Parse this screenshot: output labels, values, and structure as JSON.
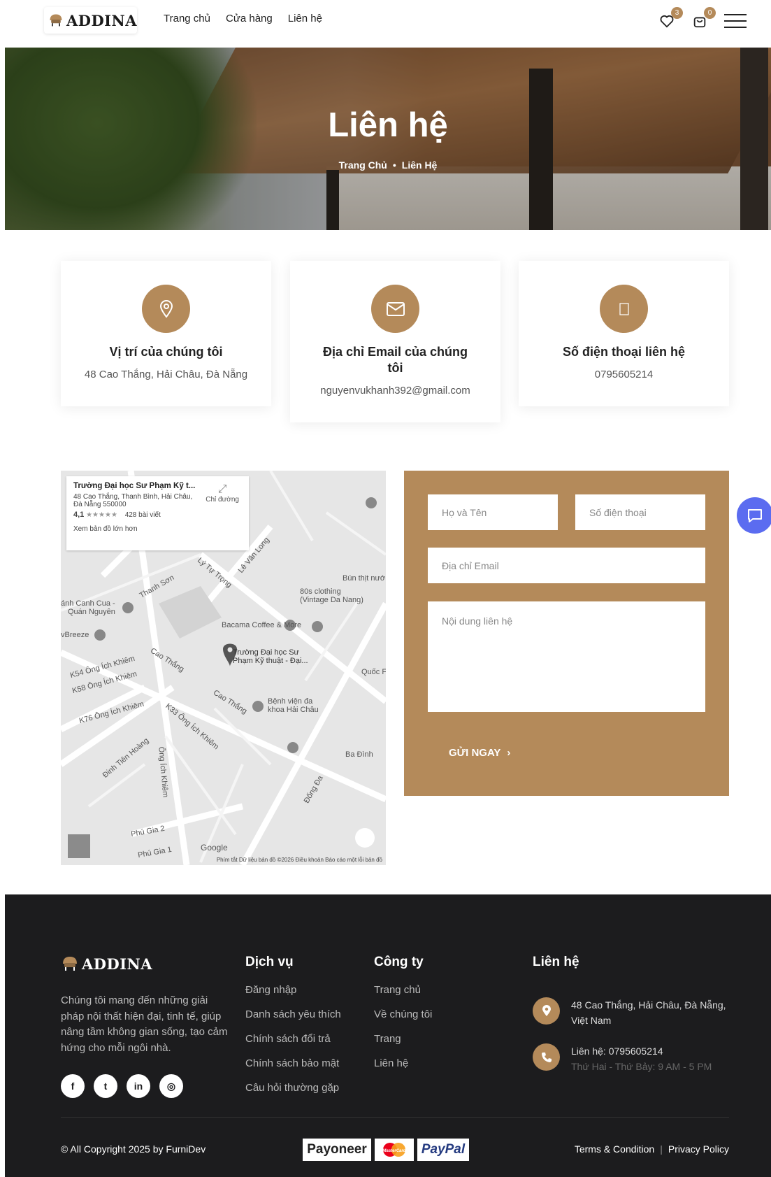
{
  "header": {
    "logo_text": "ADDINA",
    "nav": [
      "Trang chủ",
      "Cửa hàng",
      "Liên hệ"
    ],
    "wishlist_count": "3",
    "cart_count": "0"
  },
  "hero": {
    "title": "Liên hệ",
    "breadcrumb_home": "Trang Chủ",
    "breadcrumb_current": "Liên Hệ"
  },
  "cards": [
    {
      "title": "Vị trí của chúng tôi",
      "text": "48 Cao Thắng, Hải Châu, Đà Nẵng",
      "icon": "location-pin-icon"
    },
    {
      "title": "Địa chỉ Email của chúng tôi",
      "text": "nguyenvukhanh392@gmail.com",
      "icon": "envelope-icon"
    },
    {
      "title": "Số điện thoại liên hệ",
      "text": "0795605214",
      "icon": "phone-icon"
    }
  ],
  "map": {
    "place_title": "Trường Đại học Sư Phạm Kỹ t...",
    "place_address_1": "48 Cao Thắng, Thanh Bình, Hải Châu,",
    "place_address_2": "Đà Nẵng 550000",
    "rating": "4,1",
    "stars": "★★★★★",
    "reviews": "428 bài viết",
    "larger_map": "Xem bản đồ lớn hơn",
    "directions": "Chỉ đường",
    "labels": {
      "clothing_1": "80s clothing",
      "clothing_2": "(Vintage Da Nang)",
      "coffee": "Bacama Coffee & More",
      "school_1": "Trường Đại học Sư",
      "school_2": "Phạm Kỹ thuật - Đại...",
      "hospital_1": "Bệnh viện đa",
      "hospital_2": "khoa Hải Châu",
      "canh_cua_1": "ánh Canh Cua -",
      "canh_cua_2": "Quán Nguyên",
      "breeze": "vBreeze",
      "bun_thit": "Bún thịt nướ",
      "quoc": "Quốc F",
      "ba_dinh": "Ba Đình",
      "google": "Google",
      "street_cao_thang_1": "Cao Thắng",
      "street_cao_thang_2": "Cao Thắng",
      "street_k54": "K54 Ông Ích Khiêm",
      "street_k58": "K58 Ông Ích Khiêm",
      "street_k76": "K76 Ông Ích Khiêm",
      "street_k33": "K33 Ông Ích Khiêm",
      "street_ong_ich_khiem": "Ông Ích Khiêm",
      "street_ly_tu_trong": "Lý Tự Trọng",
      "street_le_van_long": "Lê Văn Long",
      "street_thanh_son": "Thanh Sơn",
      "street_dinh_tien_hoang": "Đinh Tiên Hoàng",
      "street_dong_da": "Đống Đa",
      "street_phu_gia_2": "Phú Gia 2",
      "street_phu_gia_1": "Phú Gia 1"
    },
    "footer": "Phím tắt   Dữ liệu bản đồ ©2026   Điều khoản   Báo cáo một lỗi bản đồ"
  },
  "form": {
    "name_placeholder": "Họ và Tên",
    "phone_placeholder": "Số điện thoại",
    "email_placeholder": "Địa chỉ Email",
    "message_placeholder": "Nội dung liên hệ",
    "submit_label": "GỬI NGAY",
    "submit_chevron": "›"
  },
  "footer": {
    "logo_text": "ADDINA",
    "description": "Chúng tôi mang đến những giải pháp nội thất hiện đại, tinh tế, giúp nâng tầm không gian sống, tạo cảm hứng cho mỗi ngôi nhà.",
    "socials": [
      "f",
      "t",
      "in",
      "◎"
    ],
    "services_title": "Dịch vụ",
    "services": [
      "Đăng nhập",
      "Danh sách yêu thích",
      "Chính sách đổi trả",
      "Chính sách bảo mật",
      "Câu hỏi thường gặp"
    ],
    "company_title": "Công ty",
    "company": [
      "Trang chủ",
      "Về chúng tôi",
      "Trang",
      "Liên hệ"
    ],
    "contact_title": "Liên hệ",
    "contact_address": "48 Cao Thắng, Hải Châu, Đà Nẵng, Việt Nam",
    "contact_phone": "Liên hệ: 0795605214",
    "contact_hours": "Thứ Hai - Thứ Bảy: 9 AM - 5 PM",
    "copyright": "© All Copyright 2025 by FurniDev",
    "payments": [
      "Payoneer",
      "MasterCard",
      "PayPal"
    ],
    "terms": "Terms & Condition",
    "legal_sep": "|",
    "privacy": "Privacy Policy"
  },
  "colors": {
    "accent": "#b48a5a",
    "footer_bg": "#1c1c1e",
    "chat": "#5b6cf0"
  }
}
